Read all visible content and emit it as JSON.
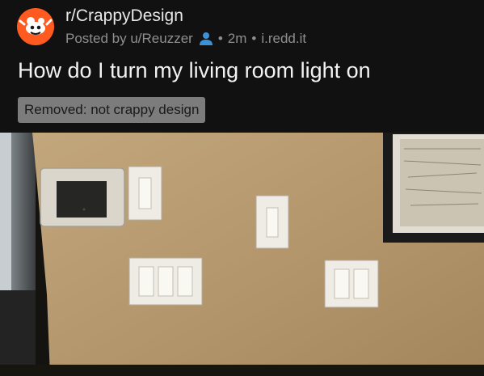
{
  "post": {
    "subreddit": "r/CrappyDesign",
    "posted_by": "Posted by u/Reuzzer",
    "age": "2m",
    "domain": "i.redd.it",
    "separator": "•",
    "title": "How do I turn my living room light on",
    "removal_badge": "Removed: not crappy design"
  },
  "icons": {
    "subreddit": "crappydesign-subreddit-icon",
    "user": "user-icon"
  },
  "colors": {
    "background": "#111111",
    "subreddit_icon": "#ff5a1f",
    "user_icon": "#3d91d6",
    "badge_bg": "#7c7c7c",
    "meta_text": "#8f8f8f",
    "wall": "#b79a72"
  }
}
